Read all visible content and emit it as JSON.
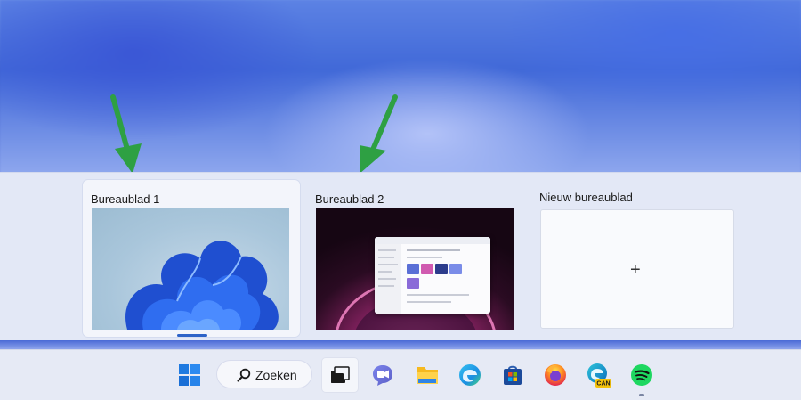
{
  "desktops": [
    {
      "label": "Bureaublad 1",
      "active": true
    },
    {
      "label": "Bureaublad 2",
      "active": false
    }
  ],
  "new_desktop": {
    "label": "Nieuw bureaublad",
    "plus": "+"
  },
  "taskbar": {
    "search_label": "Zoeken",
    "icons": [
      "windows-start-icon",
      "task-view-icon",
      "teams-chat-icon",
      "file-explorer-icon",
      "edge-icon",
      "microsoft-store-icon",
      "firefox-icon",
      "edge-canary-icon",
      "spotify-icon"
    ],
    "edge_canary_badge": "CAN"
  },
  "colors": {
    "arrow": "#2ea043",
    "accent": "#2d63c8"
  }
}
